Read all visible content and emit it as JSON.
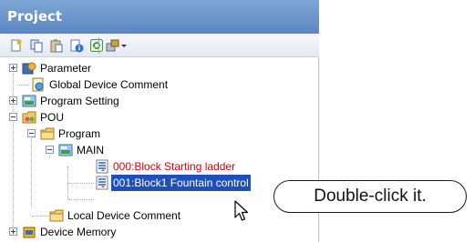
{
  "panel": {
    "title": "Project"
  },
  "toolbar": {
    "buttons": [
      {
        "icon": "new-item-icon"
      },
      {
        "icon": "copy-icon"
      },
      {
        "icon": "paste-icon"
      },
      {
        "icon": "properties-icon"
      },
      {
        "icon": "refresh-icon"
      },
      {
        "icon": "tools-dropdown-icon"
      }
    ]
  },
  "tree": {
    "parameter": "Parameter",
    "global_device_comment": "Global Device Comment",
    "program_setting": "Program Setting",
    "pou": "POU",
    "program": "Program",
    "main": "MAIN",
    "block_000": "000:Block Starting ladder",
    "block_001": "001:Block1 Fountain control",
    "local_device_comment": "Local Device Comment",
    "device_memory": "Device Memory"
  },
  "callout": {
    "text": "Double-click it."
  },
  "colors": {
    "title_bar": "#6b93c9",
    "selection": "#1f4fb8",
    "inactive_block_text": "#e30000"
  }
}
